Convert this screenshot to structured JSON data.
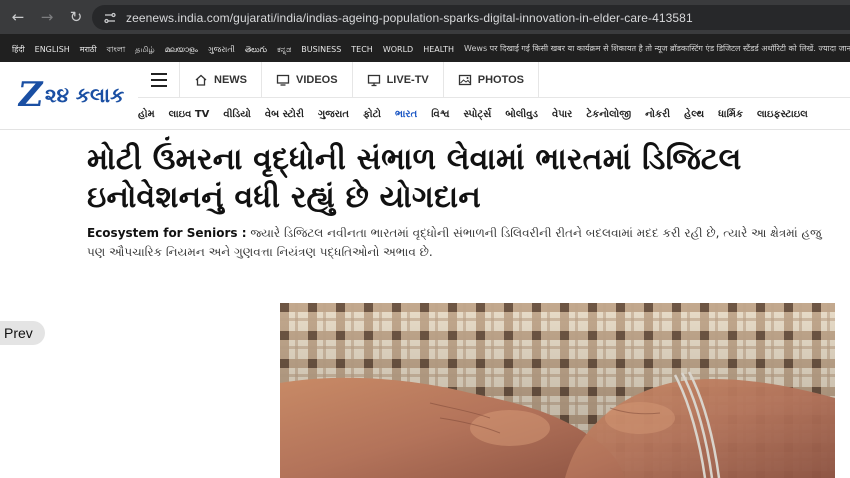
{
  "browser": {
    "back_icon": "back-arrow-icon",
    "forward_icon": "forward-arrow-icon",
    "reload_icon": "reload-icon",
    "url": "zeenews.india.com/gujarati/india/indias-ageing-population-sparks-digital-innovation-in-elder-care-413581"
  },
  "language_strip": {
    "languages": [
      "हिंदी",
      "ENGLISH",
      "मराठी",
      "বাংলা",
      "தமிழ்",
      "മലയാളം",
      "ગુજરાતી",
      "తెలుగు",
      "ಕನ್ನಡ",
      "BUSINESS",
      "TECH",
      "WORLD",
      "HEALTH"
    ],
    "ticker": "Wews पर दिखाई गई किसी खबर या कार्यक्रम से शिकायत है तो न्यूज ब्रॉडकास्टिंग एंड डिजिटल स्टैंडर्ड अथॉरिटी को लिखें. ज्यादा जानकारी के लिए"
  },
  "logo": {
    "mark": "Z",
    "text": "૨૪ કલાક"
  },
  "topnav": {
    "items": [
      {
        "label": "NEWS",
        "icon": "home-icon"
      },
      {
        "label": "VIDEOS",
        "icon": "monitor-icon"
      },
      {
        "label": "LIVE-TV",
        "icon": "tv-icon"
      },
      {
        "label": "PHOTOS",
        "icon": "photo-icon"
      }
    ]
  },
  "subnav": {
    "items": [
      "હોમ",
      "લાઇવ TV",
      "વીડિયો",
      "વેબ સ્ટોરી",
      "ગુજરાત",
      "ફોટો",
      "ભારત",
      "વિશ્વ",
      "સ્પોર્ટ્સ",
      "બોલીવુડ",
      "વેપાર",
      "ટેકનોલોજી",
      "નોકરી",
      "હેલ્થ",
      "ધાર્મિક",
      "લાઇફસ્ટાઇલ"
    ],
    "active": "ભારત"
  },
  "article": {
    "headline": "મોટી ઉંમરના વૃદ્ધોની સંભાળ લેવામાં ભારતમાં ડિજિટલ ઇનોવેશનનું વધી રહ્યું છે યોગદાન",
    "summary_label": "Ecosystem for Seniors :",
    "summary_text": " જ્યારે ડિજિટલ નવીનતા ભારતમાં વૃદ્ધોની સંભાળની ડિલિવરીની રીતને બદલવામાં મદદ કરી રહી છે, ત્યારે આ ક્ષેત્રમાં હજુ પણ ઔપચારિક નિયમન અને ગુણવત્તા નિયંત્રણ પદ્ધતિઓનો અભાવ છે."
  },
  "prev_button": {
    "label": "Prev"
  },
  "colors": {
    "brand": "#1a4fa3",
    "active_nav": "#1a56c4",
    "chrome": "#3a3b3d",
    "strip": "#202020"
  }
}
